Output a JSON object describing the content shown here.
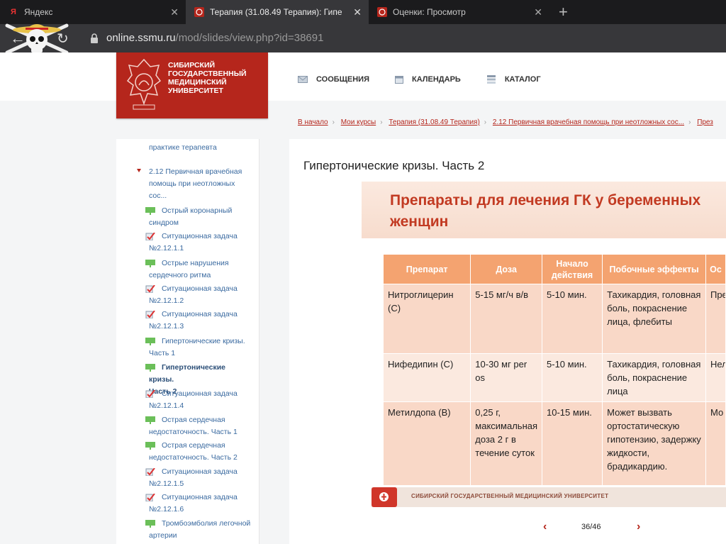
{
  "browser": {
    "tabs": [
      {
        "title": "Яндекс",
        "icon": "yandex-icon"
      },
      {
        "title": "Терапия (31.08.49 Терапия): Гипе",
        "icon": "university-crest-icon"
      },
      {
        "title": "Оценки: Просмотр",
        "icon": "university-crest-icon"
      }
    ],
    "new_tab": "+",
    "url_host": "online.ssmu.ru",
    "url_path": "/mod/slides/view.php?id=38691"
  },
  "site": {
    "logo_text": "Сибирский государственный медицинский университет",
    "nav": [
      {
        "label": "Сообщения",
        "icon": "envelope-icon"
      },
      {
        "label": "Календарь",
        "icon": "calendar-icon"
      },
      {
        "label": "Каталог",
        "icon": "catalog-icon"
      }
    ],
    "breadcrumbs": [
      "В начало",
      "Мои курсы",
      "Терапия (31.08.49 Терапия)",
      "2.12 Первичная врачебная помощь при неотложных сос...",
      "През"
    ],
    "accent": "#b5261c"
  },
  "sidebar": {
    "items": [
      {
        "label": "практике терапевта",
        "type": "text"
      },
      {
        "label": "2.12 Первичная врачебная\nпомощь при неотложных\nсос...",
        "type": "section"
      },
      {
        "label": "Острый коронарный\nсиндром",
        "type": "slides"
      },
      {
        "label": "Ситуационная задача\n№2.12.1.1",
        "type": "quiz"
      },
      {
        "label": "Острые нарушения\nсердечного ритма",
        "type": "slides"
      },
      {
        "label": "Ситуационная задача\n№2.12.1.2",
        "type": "quiz"
      },
      {
        "label": "Ситуационная задача\n№2.12.1.3",
        "type": "quiz"
      },
      {
        "label": "Гипертонические кризы.\nЧасть 1",
        "type": "slides"
      },
      {
        "label": "Гипертонические кризы.\nЧасть 2",
        "type": "slides",
        "active": true
      },
      {
        "label": "Ситуационная задача\n№2.12.1.4",
        "type": "quiz"
      },
      {
        "label": "Острая сердечная\nнедостаточность. Часть 1",
        "type": "slides"
      },
      {
        "label": "Острая сердечная\nнедостаточность. Часть 2",
        "type": "slides"
      },
      {
        "label": "Ситуационная задача\n№2.12.1.5",
        "type": "quiz"
      },
      {
        "label": "Ситуационная задача\n№2.12.1.6",
        "type": "quiz"
      },
      {
        "label": "Тромбоэмболия легочной\nартерии",
        "type": "slides"
      }
    ]
  },
  "content": {
    "title": "Гипертонические кризы. Часть 2",
    "slide": {
      "title": "Препараты для лечения ГК у беременных женщин",
      "headers": [
        "Препарат",
        "Доза",
        "Начало действия",
        "Побочные эффекты",
        "Ос"
      ],
      "rows": [
        [
          "Нитроглицерин (С)",
          "5-15 мг/ч в/в",
          "5-10 мин.",
          "Тахикардия, головная боль, покраснение лица, флебиты",
          "Пре при осл оте"
        ],
        [
          "Нифедипин (С)",
          "10-30 мг per os",
          "5-10 мин.",
          "Тахикардия, головная боль, покраснение лица",
          "Нел суб"
        ],
        [
          "Метилдопа (В)",
          "0,25 г, максимальная доза 2 г в течение суток",
          "10-15 мин.",
          "Может вызвать ортостатическую гипотензию, задержку жидкости, брадикардию.",
          "Мо пов тем инф заб"
        ]
      ],
      "footer": "Сибирский государственный медицинский университет"
    },
    "pager": {
      "prev": "‹",
      "page": "36/46",
      "next": "›"
    }
  }
}
